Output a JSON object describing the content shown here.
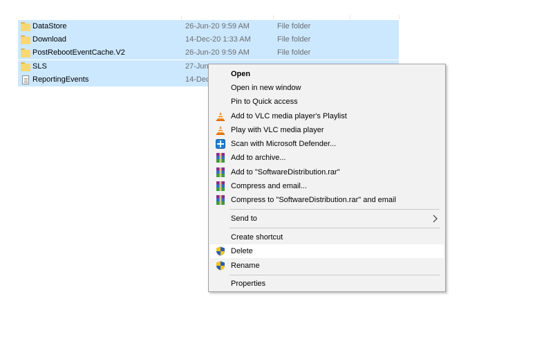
{
  "files": [
    {
      "name": "DataStore",
      "date": "26-Jun-20 9:59 AM",
      "type": "File folder",
      "icon": "folder-icon"
    },
    {
      "name": "Download",
      "date": "14-Dec-20 1:33 AM",
      "type": "File folder",
      "icon": "folder-icon"
    },
    {
      "name": "PostRebootEventCache.V2",
      "date": "26-Jun-20 9:59 AM",
      "type": "File folder",
      "icon": "folder-icon"
    },
    {
      "name": "SLS",
      "date": "27-Jun",
      "type": "",
      "icon": "folder-icon"
    },
    {
      "name": "ReportingEvents",
      "date": "14-Dec",
      "type": "",
      "icon": "document-icon"
    }
  ],
  "context_menu": {
    "open": "Open",
    "open_new_window": "Open in new window",
    "pin_quick_access": "Pin to Quick access",
    "vlc_add_playlist": "Add to VLC media player's Playlist",
    "vlc_play": "Play with VLC media player",
    "scan_defender": "Scan with Microsoft Defender...",
    "add_archive": "Add to archive...",
    "add_rar": "Add to \"SoftwareDistribution.rar\"",
    "compress_email": "Compress and email...",
    "compress_rar_email": "Compress to \"SoftwareDistribution.rar\" and email",
    "send_to": "Send to",
    "create_shortcut": "Create shortcut",
    "delete": "Delete",
    "rename": "Rename",
    "properties": "Properties",
    "hovered_item": "Delete"
  },
  "colors": {
    "selection": "#cce8ff",
    "menu_background": "#f2f2f2",
    "menu_hover": "#ffffff",
    "secondary_text": "#6d6d6d"
  }
}
